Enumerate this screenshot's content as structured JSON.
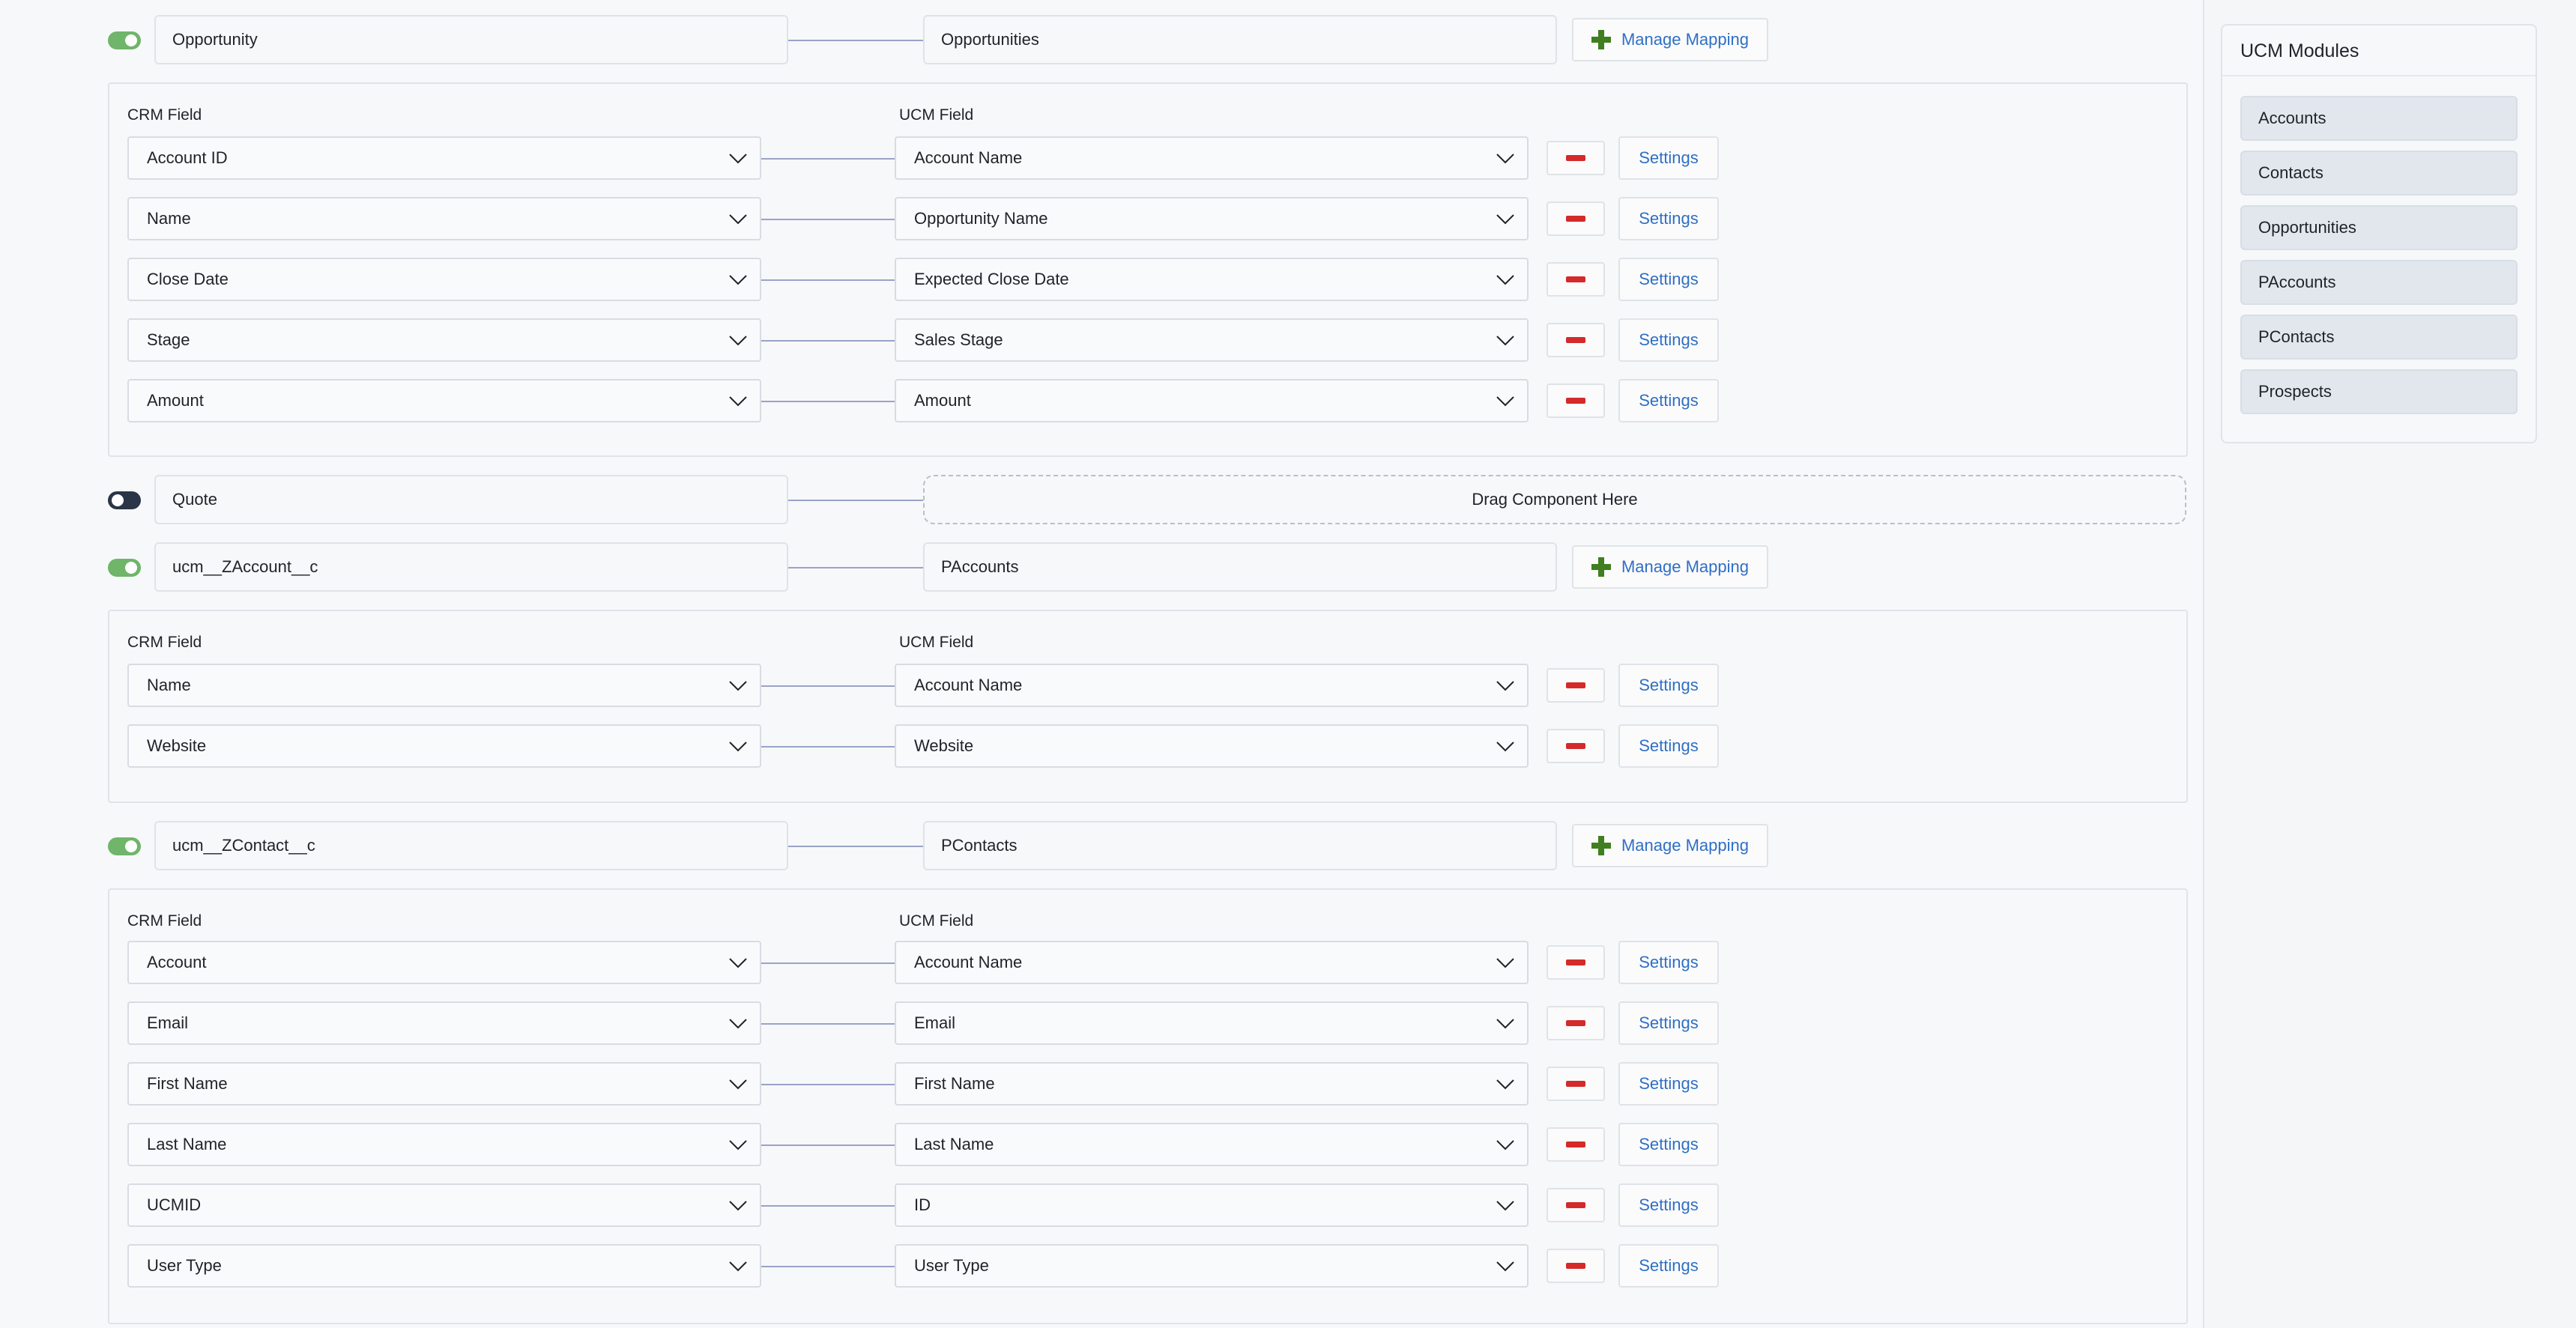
{
  "mappings": [
    {
      "enabled": true,
      "crm_module": "Opportunity",
      "ucm_module": "Opportunities",
      "manage_label": "Manage Mapping",
      "crm_header": "CRM Field",
      "ucm_header": "UCM Field",
      "rows": [
        {
          "crm": "Account ID",
          "ucm": "Account Name",
          "settings": "Settings"
        },
        {
          "crm": "Name",
          "ucm": "Opportunity Name",
          "settings": "Settings"
        },
        {
          "crm": "Close Date",
          "ucm": "Expected Close Date",
          "settings": "Settings"
        },
        {
          "crm": "Stage",
          "ucm": "Sales Stage",
          "settings": "Settings"
        },
        {
          "crm": "Amount",
          "ucm": "Amount",
          "settings": "Settings"
        }
      ]
    },
    {
      "enabled": false,
      "crm_module": "Quote",
      "drop_zone": "Drag Component Here"
    },
    {
      "enabled": true,
      "crm_module": "ucm__ZAccount__c",
      "ucm_module": "PAccounts",
      "manage_label": "Manage Mapping",
      "crm_header": "CRM Field",
      "ucm_header": "UCM Field",
      "rows": [
        {
          "crm": "Name",
          "ucm": "Account Name",
          "settings": "Settings"
        },
        {
          "crm": "Website",
          "ucm": "Website",
          "settings": "Settings"
        }
      ]
    },
    {
      "enabled": true,
      "crm_module": "ucm__ZContact__c",
      "ucm_module": "PContacts",
      "manage_label": "Manage Mapping",
      "crm_header": "CRM Field",
      "ucm_header": "UCM Field",
      "rows": [
        {
          "crm": "Account",
          "ucm": "Account Name",
          "settings": "Settings"
        },
        {
          "crm": "Email",
          "ucm": "Email",
          "settings": "Settings"
        },
        {
          "crm": "First Name",
          "ucm": "First Name",
          "settings": "Settings"
        },
        {
          "crm": "Last Name",
          "ucm": "Last Name",
          "settings": "Settings"
        },
        {
          "crm": "UCMID",
          "ucm": "ID",
          "settings": "Settings"
        },
        {
          "crm": "User Type",
          "ucm": "User Type",
          "settings": "Settings"
        }
      ]
    }
  ],
  "sidebar": {
    "title": "UCM Modules",
    "items": [
      "Accounts",
      "Contacts",
      "Opportunities",
      "PAccounts",
      "PContacts",
      "Prospects"
    ]
  },
  "colors": {
    "toggle_on": "#6fb56a",
    "toggle_off": "#2a3547",
    "link_blue": "#2f6fc4",
    "remove_red": "#d42a2a",
    "plus_green": "#3f7f1f"
  },
  "icons": {
    "plus": "plus-icon",
    "remove": "minus-icon",
    "dropdown": "chevron-down-icon"
  }
}
